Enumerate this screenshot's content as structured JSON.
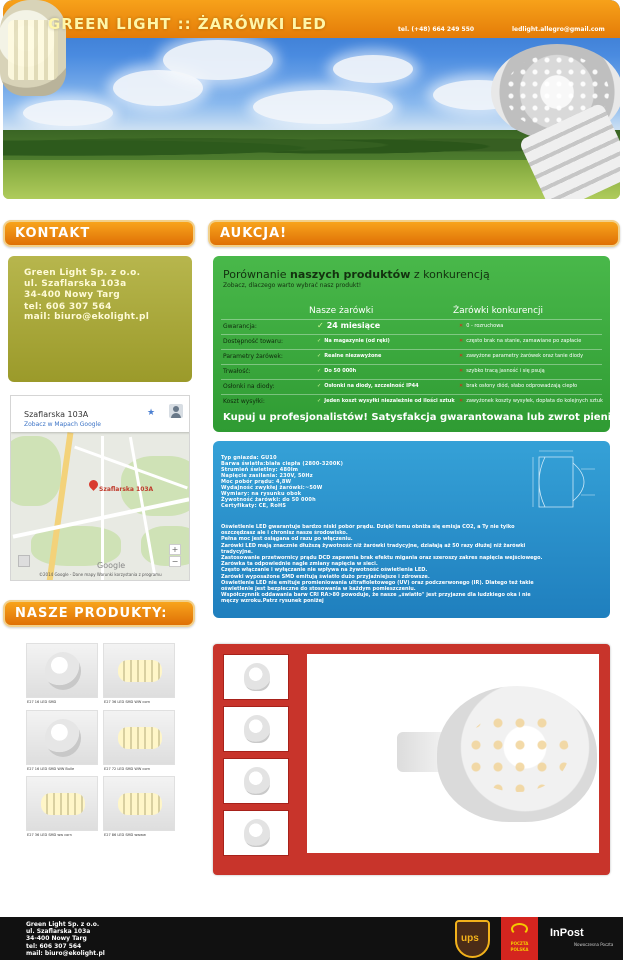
{
  "header": {
    "title": "GREEN LIGHT :: ŻARÓWKI LED",
    "phone": "tel. (+48) 664 249 550",
    "email": "ledlight.allegro@gmail.com"
  },
  "tabs": {
    "contact": "KONTAKT",
    "auction": "AUKCJA!",
    "products": "NASZE PRODUKTY:"
  },
  "contact": {
    "lines": [
      "Green Light Sp. z o.o.",
      "ul. Szaflarska 103a",
      "34-400 Nowy Targ",
      "tel: 606 307 564",
      "mail: biuro@ekolight.pl"
    ]
  },
  "map": {
    "title": "Szaflarska 103A",
    "link": "Zobacz w Mapach Google",
    "pin_label": "Szaflarska 103A",
    "footer": "©2014 Google - Dane mapy    Warunki korzystania z programu",
    "brand": "Google",
    "zoom_in": "+",
    "zoom_out": "−"
  },
  "products": [
    {
      "caption": "E27 16 LED SMD"
    },
    {
      "caption": "E27 36 LED SMD WW corn"
    },
    {
      "caption": "E27 16 LED SMD WW Bulle"
    },
    {
      "caption": "E27 72 LED SMD WW corn"
    },
    {
      "caption": "E27 36 LED SMD ww corn"
    },
    {
      "caption": "E27 86 LED SMD wwww"
    }
  ],
  "comparison": {
    "title_pre": "Porównanie ",
    "title_bold": "naszych produktów",
    "title_post": " z konkurencją",
    "subtitle": "Zobacz, dlaczego warto wybrać nasz produkt!",
    "col_ours": "Nasze żarówki",
    "col_theirs": "Żarówki konkurencji",
    "rows": [
      {
        "label": "Gwarancja:",
        "ours": "24 miesiące",
        "theirs": "0 - rozruchowa"
      },
      {
        "label": "Dostępność towaru:",
        "ours": "Na magazynie (od ręki)",
        "theirs": "często brak na stanie, zamawiane po zapłacie"
      },
      {
        "label": "Parametry żarówek:",
        "ours": "Realne niezawyżone",
        "theirs": "zawyżone parametry żarówek oraz tanie diody"
      },
      {
        "label": "Trwałość:",
        "ours": "Do 50 000h",
        "theirs": "szybko tracą jasność i się psują"
      },
      {
        "label": "Osłonki na diody:",
        "ours": "Osłonki na diody, szczelność IP44",
        "theirs": "brak osłony diód, słabo odprowadzają ciepło"
      },
      {
        "label": "Koszt wysyłki:",
        "ours": "Jeden koszt wysyłki niezależnie od ilości sztuk",
        "theirs": "zawyżonek koszty wysyłek, dopłata do kolejnych sztuk"
      }
    ],
    "check_mark": "✓",
    "cross_mark": "✕",
    "footer": "Kupuj u profesjonalistów! Satysfakcja gwarantowana lub zwrot pieniędzy!"
  },
  "spec": {
    "lines": [
      "Typ gniazda:    GU10",
      "Barwa światła:biała ciepła (2800-3200K)",
      "Strumień świetlny:    480lm",
      "Napięcie zasilania:    230V, 50Hz",
      "Moc pobór prądu:    4,8W",
      "Wydajność zwykłej żarówki:~50W",
      "Wymiary:         na rysunku obok",
      "Żywotność żarówki:  do 50 000h",
      "Certyfikaty:     CE, RoHS"
    ],
    "description": [
      "Oświetlenie LED gwarantuje bardzo niski pobór prądu. Dzięki temu obniża się emisja CO2, a Ty nie tylko",
      "oszczędzasz ale i chronisz nasze środowisko.",
      "Pełna moc jest osiągana od razu po włączeniu.",
      "Żarówki LED mają znacznie dłuższą żywotność niż żarówki tradycyjne, działają aż 50 razy dłużej niż żarówki",
      "tradycyjne.",
      "Zastosowanie przetwornicy prądu DCD zapewnia brak efektu migania oraz szeroszy zakres napięcia wejściowego.",
      "Żarówka ta odpowiednie nagle zmiany napięcia w sieci.",
      "Często włączanie i wyłączanie nie wpływa na żywotność oświetlenia LED.",
      "Żarówki wyposażone SMD emitują światło dużo przyjaźniejsze i zdrowsze.",
      "Oświetlenie LED nie emituje promieniowania ultrafioletowego (UV) oraz podczerwonego (IR). Dlatego też takie",
      "oświetlenie jest bezpieczne do stosowania w każdym pomieszczeniu.",
      "Współczynnik oddawania barw CRI RA>80 powoduje, że nasze „światło\" jest przyjazne dla ludzkiego oka i nie",
      "męczy wzroku.Patrz rysunek poniżej"
    ]
  },
  "footer": {
    "lines": [
      "Green Light Sp. z o.o.",
      "ul. Szaflarska 103a",
      "34-400 Nowy Targ",
      "tel: 606 307 564",
      "mail: biuro@ekolight.pl"
    ],
    "ups": "ups",
    "poczta_1": "POCZTA",
    "poczta_2": "POLSKA",
    "inpost": "InPost",
    "inpost_sub": "Nowoczesna Poczta"
  },
  "colors": {
    "orange": "#e47c08",
    "olive": "#9b9a2a",
    "green": "#2f9b33",
    "blue": "#1f7fbe",
    "red": "#c8342b"
  }
}
